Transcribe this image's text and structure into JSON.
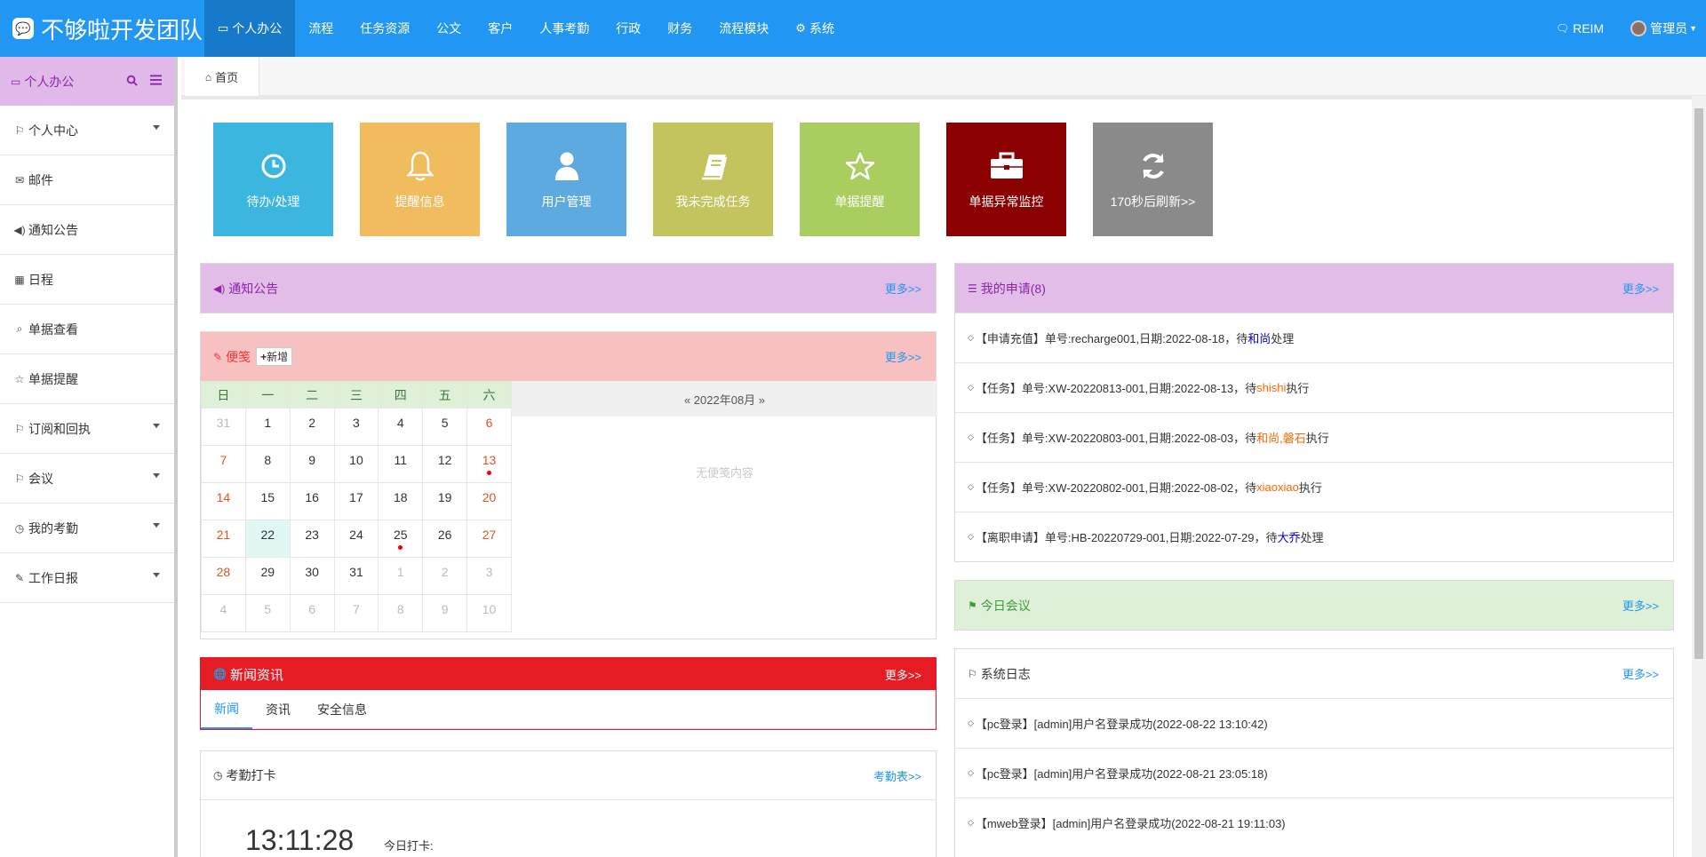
{
  "brand": {
    "logo": "💬",
    "title": "不够啦开发团队"
  },
  "topnav": {
    "items": [
      {
        "label": "个人办公",
        "icon": "monitor-icon",
        "active": true
      },
      {
        "label": "流程"
      },
      {
        "label": "任务资源"
      },
      {
        "label": "公文"
      },
      {
        "label": "客户"
      },
      {
        "label": "人事考勤"
      },
      {
        "label": "行政"
      },
      {
        "label": "财务"
      },
      {
        "label": "流程模块"
      },
      {
        "label": "系统",
        "icon": "gear-icon"
      }
    ],
    "reim": "REIM",
    "user": "管理员"
  },
  "sidebar": {
    "title": "个人办公",
    "items": [
      {
        "label": "个人中心",
        "icon": "bookmark-icon",
        "expandable": true
      },
      {
        "label": "邮件",
        "icon": "envelope-icon"
      },
      {
        "label": "通知公告",
        "icon": "volume-icon"
      },
      {
        "label": "日程",
        "icon": "calendar-icon"
      },
      {
        "label": "单据查看",
        "icon": "search-icon"
      },
      {
        "label": "单据提醒",
        "icon": "star-icon"
      },
      {
        "label": "订阅和回执",
        "icon": "bookmark-icon",
        "expandable": true
      },
      {
        "label": "会议",
        "icon": "bookmark-icon",
        "expandable": true
      },
      {
        "label": "我的考勤",
        "icon": "clock-icon",
        "expandable": true
      },
      {
        "label": "工作日报",
        "icon": "edit-icon",
        "expandable": true
      }
    ]
  },
  "tabbar": {
    "home": "首页"
  },
  "tiles": [
    {
      "label": "待办/处理",
      "color": "#3bb7df",
      "icon": "clock-icon"
    },
    {
      "label": "提醒信息",
      "color": "#f0bc5e",
      "icon": "bell-icon"
    },
    {
      "label": "用户管理",
      "color": "#5daae0",
      "icon": "user-icon"
    },
    {
      "label": "我未完成任务",
      "color": "#c4c45e",
      "icon": "book-icon"
    },
    {
      "label": "单据提醒",
      "color": "#a9cd5e",
      "icon": "star-icon"
    },
    {
      "label": "单据异常监控",
      "color": "#8b0000",
      "icon": "briefcase-icon"
    },
    {
      "label": "170秒后刷新>>",
      "color": "#8a8a8a",
      "icon": "refresh-icon"
    }
  ],
  "notice": {
    "title": "通知公告",
    "more": "更多>>",
    "bg": "#e2bde8",
    "color": "#8e24aa"
  },
  "memo": {
    "title": "便笺",
    "add": "新增",
    "more": "更多>>",
    "bg": "#f7c1c1",
    "color": "#e53935",
    "month": "« 2022年08月 »",
    "empty": "无便笺内容",
    "weekdays": [
      "日",
      "一",
      "二",
      "三",
      "四",
      "五",
      "六"
    ],
    "weeks": [
      [
        "31",
        "1",
        "2",
        "3",
        "4",
        "5",
        "6"
      ],
      [
        "7",
        "8",
        "9",
        "10",
        "11",
        "12",
        "13"
      ],
      [
        "14",
        "15",
        "16",
        "17",
        "18",
        "19",
        "20"
      ],
      [
        "21",
        "22",
        "23",
        "24",
        "25",
        "26",
        "27"
      ],
      [
        "28",
        "29",
        "30",
        "31",
        "1",
        "2",
        "3"
      ],
      [
        "4",
        "5",
        "6",
        "7",
        "8",
        "9",
        "10"
      ]
    ],
    "today": "22",
    "marked_days": [
      "13",
      "25"
    ]
  },
  "news": {
    "title": "新闻资讯",
    "more": "更多>>",
    "bg": "#e61c24",
    "tabs": [
      "新闻",
      "资讯",
      "安全信息"
    ]
  },
  "attendance": {
    "title": "考勤打卡",
    "more": "考勤表>>",
    "time": "13:11:28",
    "today_label": "今日打卡:"
  },
  "my_apply": {
    "title": "我的申请(8)",
    "more": "更多>>",
    "bg": "#e2bde8",
    "color": "#8e24aa",
    "items": [
      {
        "prefix": "【申请充值】单号:recharge001,日期:2022-08-18，待",
        "who": "和尚",
        "who_color": "#0000cc",
        "suffix": "处理"
      },
      {
        "prefix": "【任务】单号:XW-20220813-001,日期:2022-08-13，待",
        "who": "shishi",
        "who_color": "#ff6600",
        "suffix": "执行"
      },
      {
        "prefix": "【任务】单号:XW-20220803-001,日期:2022-08-03，待",
        "who": "和尚,磐石",
        "who_color": "#ff6600",
        "suffix": "执行"
      },
      {
        "prefix": "【任务】单号:XW-20220802-001,日期:2022-08-02，待",
        "who": "xiaoxiao",
        "who_color": "#ff6600",
        "suffix": "执行"
      },
      {
        "prefix": "【离职申请】单号:HB-20220729-001,日期:2022-07-29，待",
        "who": "大乔",
        "who_color": "#0000cc",
        "suffix": "处理"
      }
    ]
  },
  "meeting": {
    "title": "今日会议",
    "more": "更多>>",
    "bg": "#dff0d8",
    "color": "#3c9c3c"
  },
  "syslog": {
    "title": "系统日志",
    "more": "更多>>",
    "items": [
      "【pc登录】[admin]用户名登录成功(2022-08-22 13:10:42)",
      "【pc登录】[admin]用户名登录成功(2022-08-21 23:05:18)",
      "【mweb登录】[admin]用户名登录成功(2022-08-21 19:11:03)"
    ]
  }
}
